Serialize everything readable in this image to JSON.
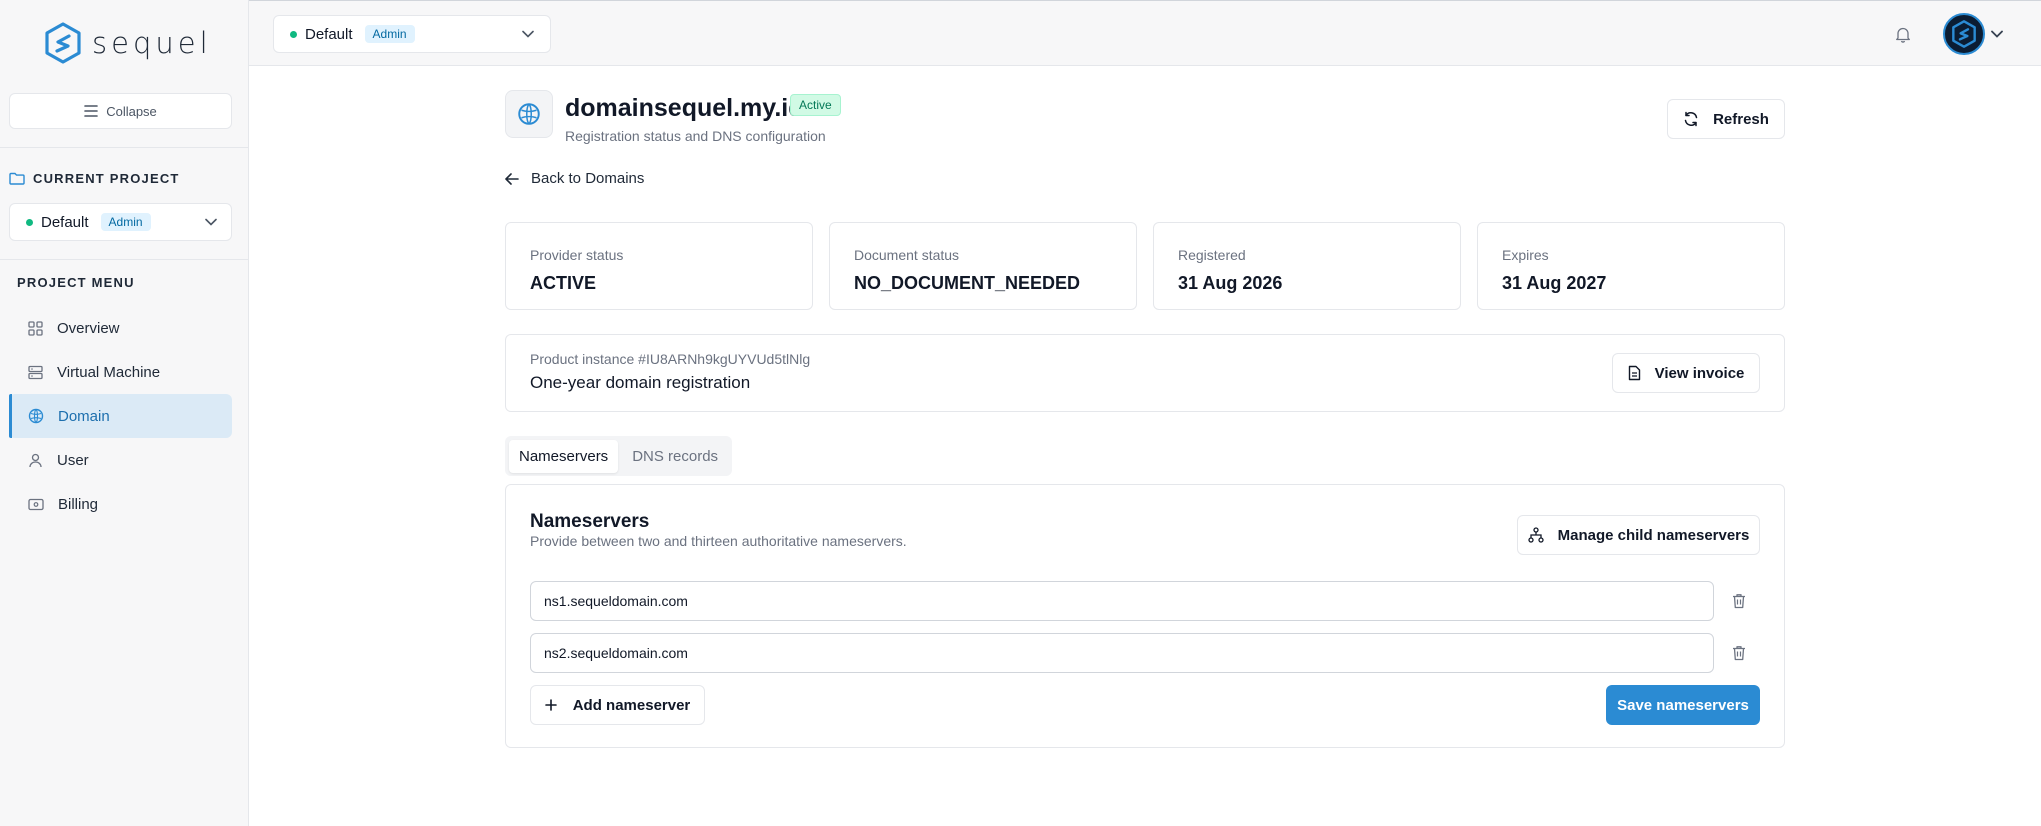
{
  "brand": {
    "name": "sequel",
    "accent": "#2b8bd3"
  },
  "sidebar": {
    "collapse_label": "Collapse",
    "current_project_title": "CURRENT PROJECT",
    "project": {
      "name": "Default",
      "role": "Admin"
    },
    "menu_title": "PROJECT MENU",
    "items": [
      {
        "label": "Overview",
        "icon": "grid-icon",
        "active": false
      },
      {
        "label": "Virtual Machine",
        "icon": "server-icon",
        "active": false
      },
      {
        "label": "Domain",
        "icon": "globe-icon",
        "active": true
      },
      {
        "label": "User",
        "icon": "user-icon",
        "active": false
      },
      {
        "label": "Billing",
        "icon": "wallet-icon",
        "active": false
      }
    ]
  },
  "topbar": {
    "project": {
      "name": "Default",
      "role": "Admin"
    },
    "bell_icon": "bell-icon",
    "avatar_icon": "avatar-icon"
  },
  "page": {
    "domain": "domainsequel.my.id",
    "status": "Active",
    "subtitle": "Registration status and DNS configuration",
    "refresh_label": "Refresh",
    "back_label": "Back to Domains",
    "stats": [
      {
        "label": "Provider status",
        "value": "ACTIVE"
      },
      {
        "label": "Document status",
        "value": "NO_DOCUMENT_NEEDED"
      },
      {
        "label": "Registered",
        "value": "31 Aug 2026"
      },
      {
        "label": "Expires",
        "value": "31 Aug 2027"
      }
    ],
    "instance": {
      "id_text": "Product instance #IU8ARNh9kgUYVUd5tlNlg",
      "name": "One-year domain registration",
      "invoice_label": "View invoice"
    },
    "tabs": [
      {
        "label": "Nameservers",
        "active": true
      },
      {
        "label": "DNS records",
        "active": false
      }
    ],
    "nameservers": {
      "title": "Nameservers",
      "description": "Provide between two and thirteen authoritative nameservers.",
      "child_label": "Manage child nameservers",
      "entries": [
        "ns1.sequeldomain.com",
        "ns2.sequeldomain.com"
      ],
      "add_label": "Add nameserver",
      "save_label": "Save nameservers"
    }
  }
}
